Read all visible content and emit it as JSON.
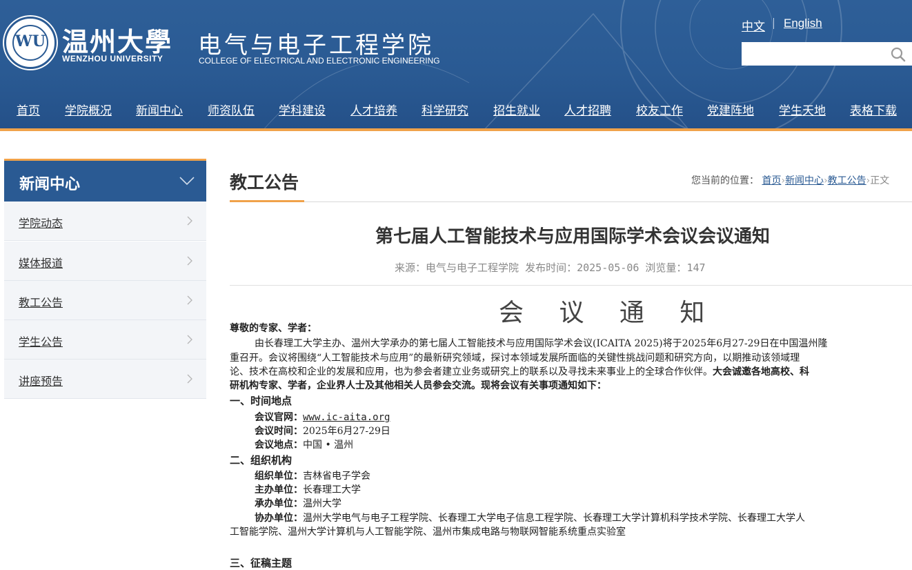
{
  "header": {
    "university_cn": "温州大學",
    "university_en": "WENZHOU UNIVERSITY",
    "college_cn": "电气与电子工程学院",
    "college_en": "COLLEGE  OF ELECTRICAL AND ELECTRONIC ENGINEERING",
    "lang_cn": "中文",
    "lang_en": "English",
    "search_placeholder": ""
  },
  "nav": {
    "items": [
      "首页",
      "学院概况",
      "新闻中心",
      "师资队伍",
      "学科建设",
      "人才培养",
      "科学研究",
      "招生就业",
      "人才招聘",
      "校友工作",
      "党建阵地",
      "学生天地",
      "表格下载"
    ]
  },
  "sidebar": {
    "title": "新闻中心",
    "items": [
      "学院动态",
      "媒体报道",
      "教工公告",
      "学生公告",
      "讲座预告"
    ]
  },
  "main": {
    "section_title": "教工公告",
    "breadcrumb": {
      "prefix": "您当前的位置：",
      "home": "首页",
      "news": "新闻中心",
      "current_section": "教工公告",
      "current": "正文"
    }
  },
  "article": {
    "title": "第七届人工智能技术与应用国际学术会议会议通知",
    "meta_source_label": "来源：",
    "meta_source": "电气与电子工程学院",
    "meta_date_label": "发布时间：",
    "meta_date": "2025-05-06",
    "meta_views_label": "浏览量：",
    "meta_views": "147",
    "heading": "会 议 通 知",
    "salutation": "尊敬的专家、学者：",
    "para1_line1": "由长春理工大学主办、温州大学承办的第七届人工智能技术与应用国际学术会议(ICAITA 2025)将于2025年6月27-29日在中国温州隆",
    "para1_line2": "重召开。会议将围绕“人工智能技术与应用”的最新研究领域，探讨本领域发展所面临的关键性挑战问题和研究方向，以期推动该领域理",
    "para1_line3a": "论、技术在高校和企业的发展和应用，也为参会者建立业务或研究上的联系以及寻找未来事业上的全球合作伙伴。",
    "para1_line3b": "大会诚邀各地高校、科",
    "para1_line4": "研机构专家、学者，企业界人士及其他相关人员参会交流。现将会议有关事项通知如下：",
    "sec1_title": "一、时间地点",
    "website_label": "会议官网：",
    "website": "www.ic-aita.org",
    "time_label": "会议时间：",
    "time": "2025年6月27-29日",
    "place_label": "会议地点：",
    "place": "中国 • 温州",
    "sec2_title": "二、组织机构",
    "org_label": "组织单位：",
    "org": "吉林省电子学会",
    "host_label": "主办单位：",
    "host": "长春理工大学",
    "undertake_label": "承办单位：",
    "undertake": "温州大学",
    "co_label": "协办单位：",
    "co_line1": "温州大学电气与电子工程学院、长春理工大学电子信息工程学院、长春理工大学计算机科学技术学院、长春理工大学人",
    "co_line2": "工智能学院、温州大学计算机与人工智能学院、温州市集成电路与物联网智能系统重点实验室",
    "sec3_title": "三、征稿主题"
  }
}
